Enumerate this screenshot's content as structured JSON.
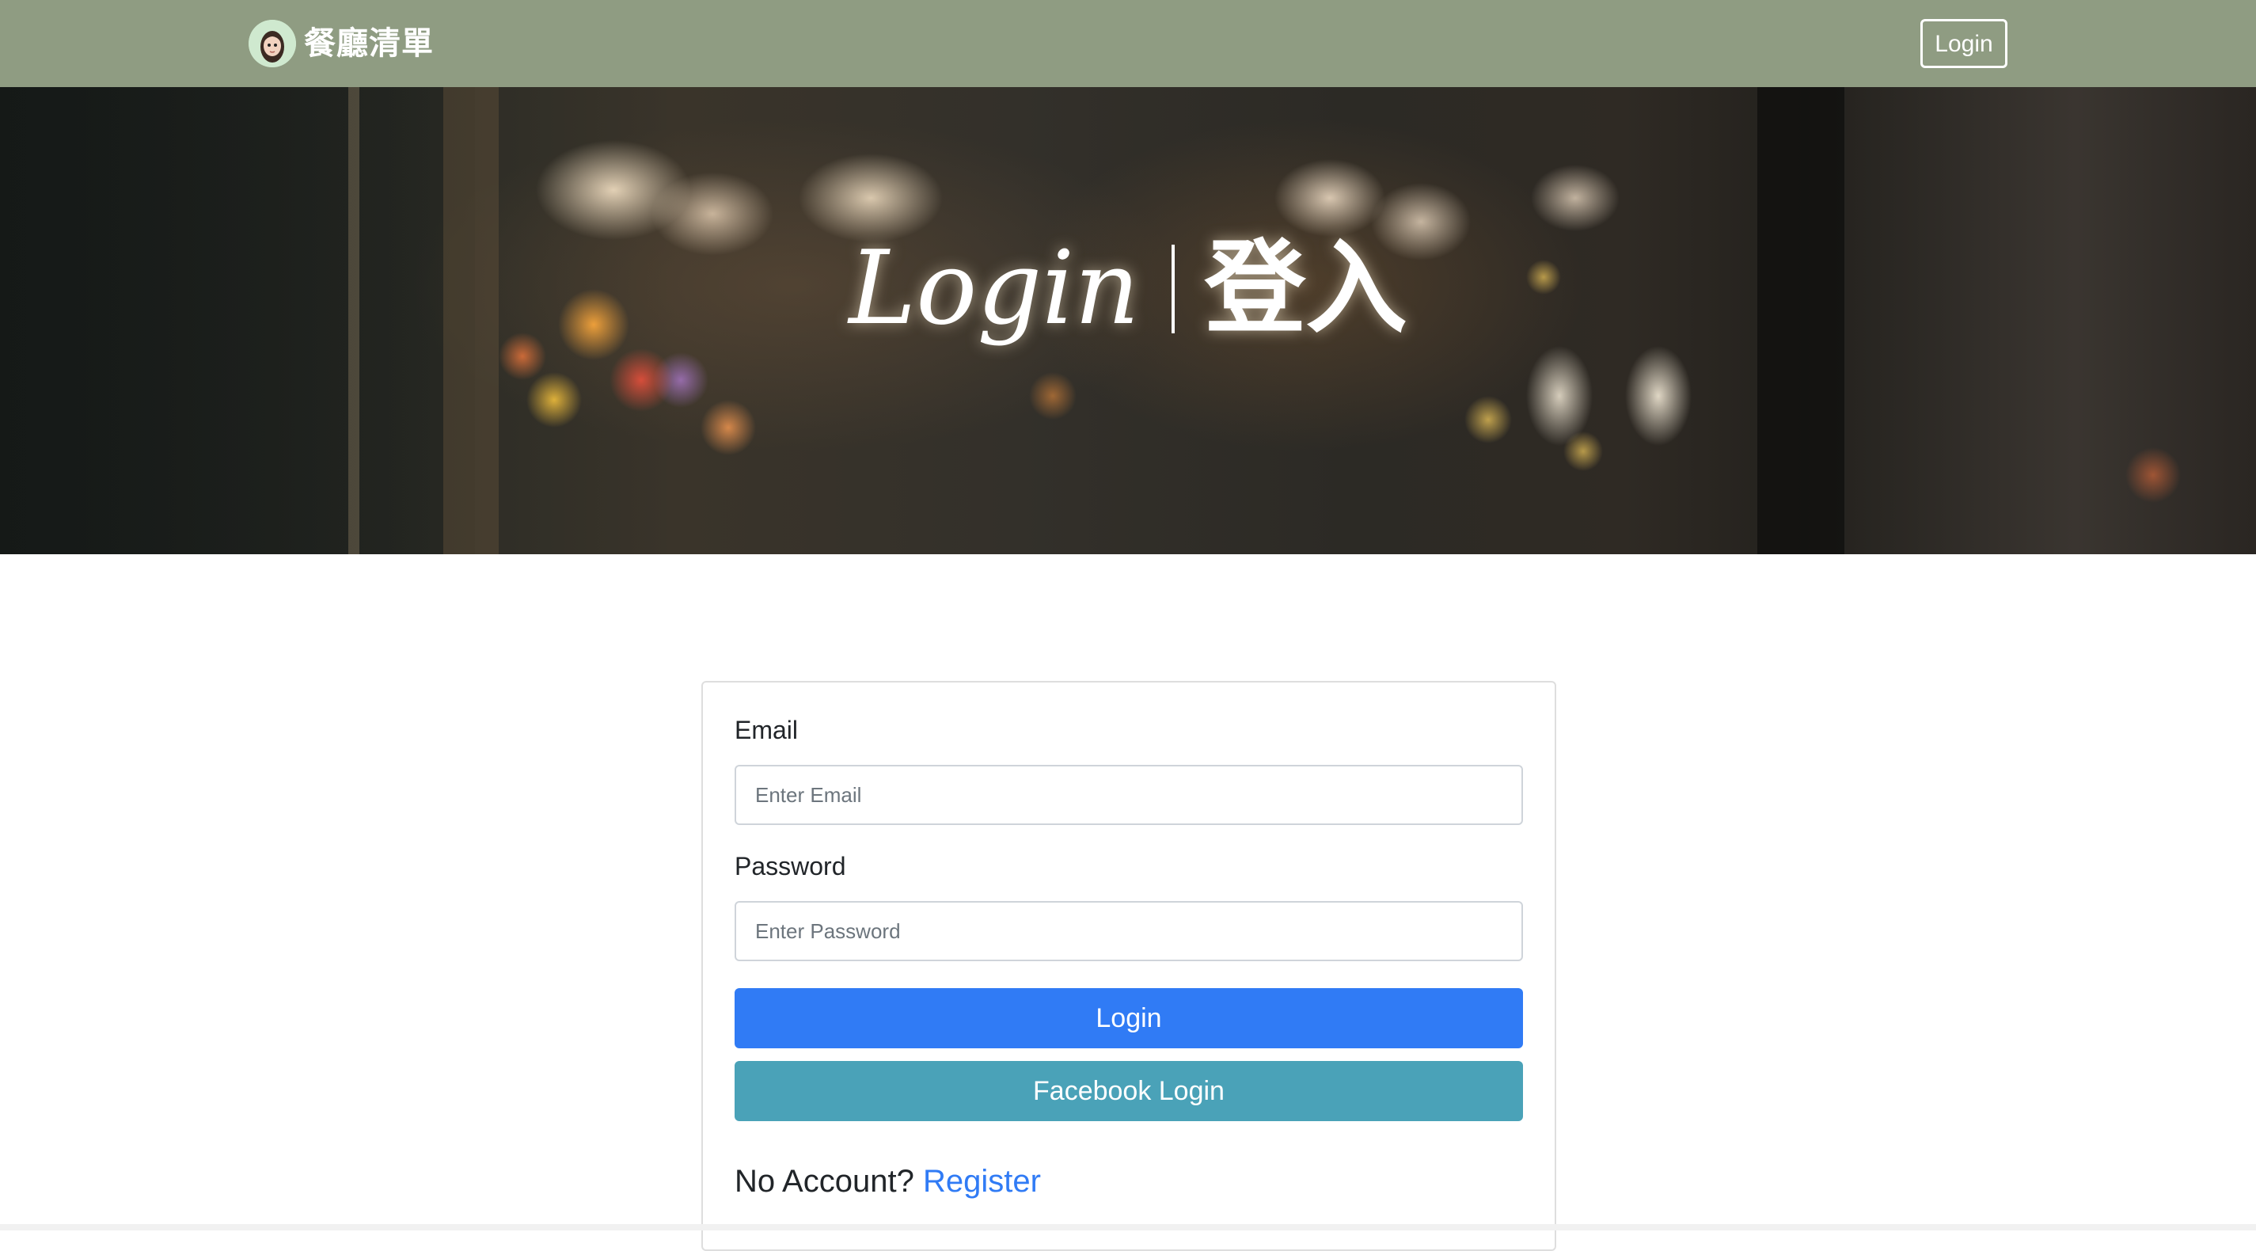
{
  "navbar": {
    "brand_name": "餐廳清單",
    "login_label": "Login",
    "background_color": "#8f9c82"
  },
  "hero": {
    "title_en": "Login",
    "title_zh": "登入"
  },
  "form": {
    "email_label": "Email",
    "email_placeholder": "Enter Email",
    "email_value": "",
    "password_label": "Password",
    "password_placeholder": "Enter Password",
    "password_value": "",
    "login_button_label": "Login",
    "facebook_button_label": "Facebook Login",
    "no_account_text": "No Account?",
    "register_link_label": "Register"
  },
  "colors": {
    "primary": "#307bf5",
    "info": "#4aa2b8"
  },
  "icons": {
    "brand_avatar": "avatar-icon"
  }
}
